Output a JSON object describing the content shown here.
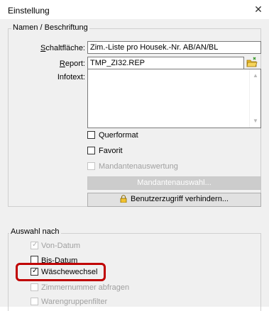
{
  "window": {
    "title": "Einstellung"
  },
  "group_names": {
    "legend": "Namen / Beschriftung",
    "schaltflaeche": {
      "label": "Schaltfläche:",
      "value": "Zim.-Liste pro Housek.-Nr. AB/AN/BL"
    },
    "report": {
      "label": "Report:",
      "value": "TMP_ZI32.REP"
    },
    "infotext": {
      "label": "Infotext:",
      "value": ""
    },
    "querformat": {
      "label": "Querformat",
      "checked": false
    },
    "favorit": {
      "label": "Favorit",
      "checked": false
    },
    "mandantenauswertung": {
      "label": "Mandantenauswertung",
      "checked": false,
      "disabled": true
    },
    "mandantenauswahl_button": "Mandantenauswahl...",
    "benutzerzugriff_button": "Benutzerzugriff verhindern..."
  },
  "group_auswahl": {
    "legend": "Auswahl nach",
    "items": [
      {
        "label": "Von-Datum",
        "checked": true,
        "disabled": true
      },
      {
        "label": "Bis-Datum",
        "checked": false,
        "disabled": false
      },
      {
        "label": "Wäschewechsel",
        "checked": true,
        "disabled": false
      },
      {
        "label": "Zimmernummer abfragen",
        "checked": false,
        "disabled": true
      },
      {
        "label": "Warengruppenfilter",
        "checked": false,
        "disabled": true
      }
    ]
  },
  "colors": {
    "highlight": "#c00000",
    "panel": "#f0f0f0"
  },
  "icons": {
    "close": "close-icon",
    "folder": "folder-icon",
    "lock": "lock-icon"
  }
}
